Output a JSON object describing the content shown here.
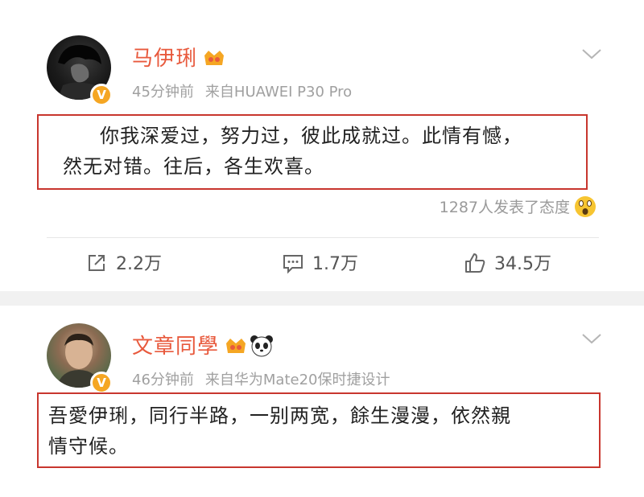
{
  "posts": [
    {
      "username": "马伊琍",
      "time": "45分钟前",
      "source": "来自HUAWEI P30 Pro",
      "content_line1": "你我深爱过，努力过，彼此成就过。此情有憾，",
      "content_line2": "然无对错。往后，各生欢喜。",
      "reactions": "1287人发表了态度",
      "shares": "2.2万",
      "comments": "1.7万",
      "likes": "34.5万"
    },
    {
      "username": "文章同學",
      "time": "46分钟前",
      "source": "来自华为Mate20保时捷设计",
      "content_line1": "吾愛伊琍，同行半路，一别两宽，餘生漫漫，依然親",
      "content_line2": "情守候。"
    }
  ],
  "verified_badge": "V",
  "colors": {
    "username": "#e8593c",
    "highlight_border": "#c8362e",
    "verified_badge": "#f5a623",
    "meta_text": "#a0a0a0"
  },
  "icons": [
    "crown-badge-icon",
    "panda-emoji-icon",
    "verified-icon",
    "chevron-down-icon",
    "wow-emoji-icon",
    "share-icon",
    "comment-icon",
    "like-icon"
  ]
}
